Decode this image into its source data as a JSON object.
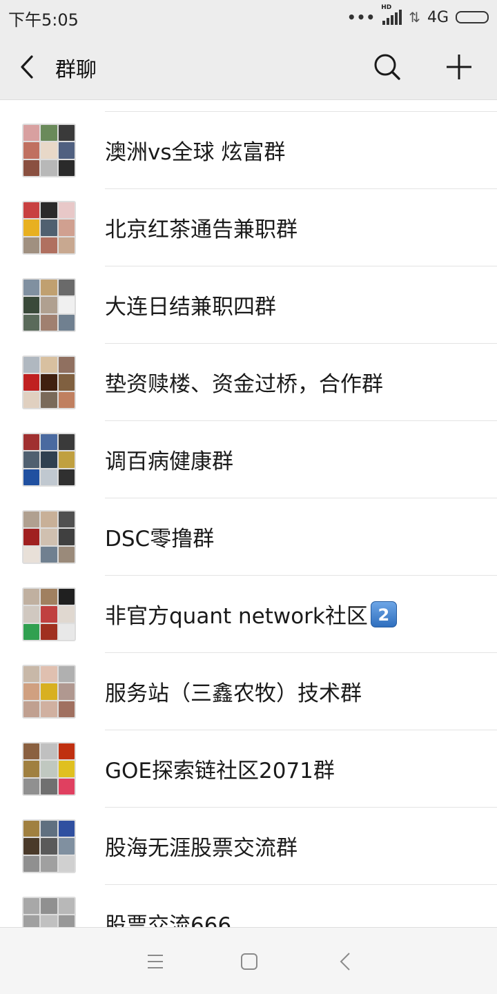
{
  "status_bar": {
    "time": "下午5:05",
    "dots": "•••",
    "hd": "HD",
    "network": "4G",
    "data_arrows": "⇅"
  },
  "header": {
    "title": "群聊",
    "back_icon": "chevron-left-icon",
    "search_icon": "search-icon",
    "add_icon": "plus-icon"
  },
  "groups": [
    {
      "name": "",
      "badge": ""
    },
    {
      "name": "澳洲vs全球 炫富群",
      "badge": ""
    },
    {
      "name": "北京红茶通告兼职群",
      "badge": ""
    },
    {
      "name": "大连日结兼职四群",
      "badge": ""
    },
    {
      "name": "垫资赎楼、资金过桥，合作群",
      "badge": ""
    },
    {
      "name": "调百病健康群",
      "badge": ""
    },
    {
      "name": "DSC零撸群",
      "badge": ""
    },
    {
      "name": "非官方quant network社区",
      "badge": "2"
    },
    {
      "name": "服务站（三鑫农牧）技术群",
      "badge": ""
    },
    {
      "name": "GOE探索链社区2071群",
      "badge": ""
    },
    {
      "name": "股海无涯股票交流群",
      "badge": ""
    },
    {
      "name": "股票交流666",
      "badge": ""
    }
  ],
  "nav_bar": {
    "menu_icon": "menu-icon",
    "home_icon": "home-icon",
    "back_icon": "back-triangle-icon"
  }
}
